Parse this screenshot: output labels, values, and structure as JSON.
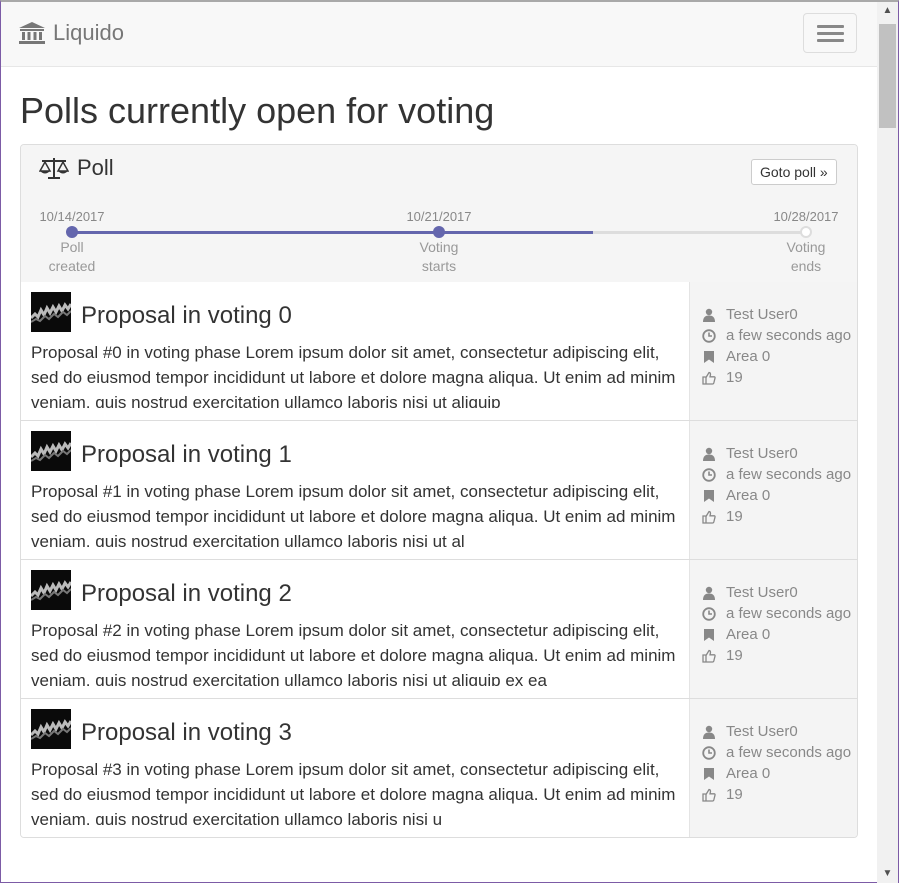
{
  "navbar": {
    "brand": "Liquido"
  },
  "page_title": "Polls currently open for voting",
  "poll": {
    "title": "Poll",
    "goto_button": "Goto poll »",
    "timeline": {
      "progress_fraction": 0.71,
      "milestones": [
        {
          "date": "10/14/2017",
          "label": "Poll created",
          "line1": "Poll",
          "line2": "created",
          "reached": true
        },
        {
          "date": "10/21/2017",
          "label": "Voting starts",
          "line1": "Voting",
          "line2": "starts",
          "reached": true
        },
        {
          "date": "10/28/2017",
          "label": "Voting ends",
          "line1": "Voting",
          "line2": "ends",
          "reached": false
        }
      ]
    }
  },
  "proposals": [
    {
      "title": "Proposal in voting 0",
      "text": "Proposal #0 in voting phase Lorem ipsum dolor sit amet, consectetur adipiscing elit, sed do eiusmod tempor incididunt ut labore et dolore magna aliqua. Ut enim ad minim veniam, quis nostrud exercitation ullamco laboris nisi ut aliquip",
      "author": "Test User0",
      "time": "a few seconds ago",
      "area": "Area 0",
      "likes": "19"
    },
    {
      "title": "Proposal in voting 1",
      "text": "Proposal #1 in voting phase Lorem ipsum dolor sit amet, consectetur adipiscing elit, sed do eiusmod tempor incididunt ut labore et dolore magna aliqua. Ut enim ad minim veniam, quis nostrud exercitation ullamco laboris nisi ut al",
      "author": "Test User0",
      "time": "a few seconds ago",
      "area": "Area 0",
      "likes": "19"
    },
    {
      "title": "Proposal in voting 2",
      "text": "Proposal #2 in voting phase Lorem ipsum dolor sit amet, consectetur adipiscing elit, sed do eiusmod tempor incididunt ut labore et dolore magna aliqua. Ut enim ad minim veniam, quis nostrud exercitation ullamco laboris nisi ut aliquip ex ea",
      "author": "Test User0",
      "time": "a few seconds ago",
      "area": "Area 0",
      "likes": "19"
    },
    {
      "title": "Proposal in voting 3",
      "text": "Proposal #3 in voting phase Lorem ipsum dolor sit amet, consectetur adipiscing elit, sed do eiusmod tempor incididunt ut labore et dolore magna aliqua. Ut enim ad minim veniam, quis nostrud exercitation ullamco laboris nisi u",
      "author": "Test User0",
      "time": "a few seconds ago",
      "area": "Area 0",
      "likes": "19"
    }
  ],
  "colors": {
    "accent": "#6466ad",
    "navbar_bg": "#f8f8f8",
    "panel_head_bg": "#f5f5f5",
    "side_bg": "#f4f4f4"
  },
  "icons": {
    "brand": "bank-icon",
    "poll": "balance-scale-icon",
    "menu": "hamburger-icon",
    "author": "user-icon",
    "time": "clock-icon",
    "area": "bookmark-icon",
    "likes": "thumbs-up-icon"
  }
}
